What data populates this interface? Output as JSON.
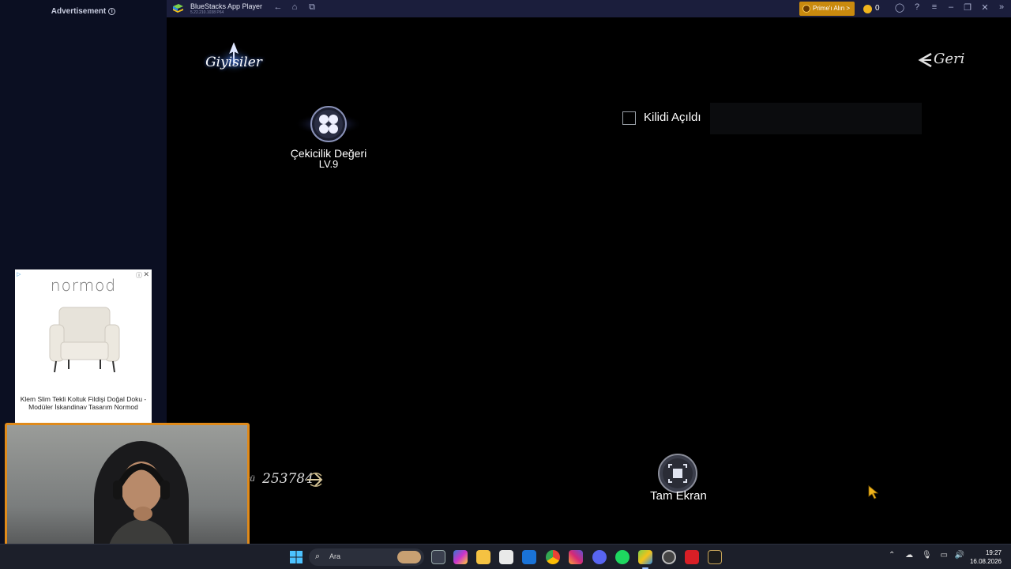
{
  "sidebar": {
    "ad_label": "Advertisement",
    "ad": {
      "brand": "normod",
      "caption": "Klem Slim Tekli Koltuk Fildişi Doğal Doku - Modüler İskandinav Tasarım Normod"
    }
  },
  "titlebar": {
    "app_name": "BlueStacks App Player",
    "version": "5.22.210.1038  P64",
    "prime_button": "Prime'ı Alın >",
    "coin_count": "0"
  },
  "game": {
    "clothes_tab": "Giyisiler",
    "back_button": "Geri",
    "charm": {
      "name": "Çekicilik Değeri",
      "level": "LV.9"
    },
    "unlock_filter": {
      "label": "Kilidi Açıldı",
      "checked": false
    },
    "currency": {
      "prefix": "cü",
      "value": "253784"
    },
    "fullscreen_button": "Tam Ekran"
  },
  "taskbar": {
    "search_placeholder": "Ara",
    "apps": [
      "file-explorer-icon",
      "m365-icon",
      "folder-icon",
      "store-icon",
      "outlook-icon",
      "chrome-icon",
      "instagram-icon",
      "discord-icon",
      "spotify-icon",
      "bluestacks-icon",
      "obs-icon",
      "netflix-icon",
      "league-icon"
    ],
    "time": "19:27",
    "date": "16.08.2026"
  },
  "colors": {
    "accent_orange": "#e08a1a",
    "titlebar_bg": "#1b1e3c",
    "prime_gold": "#c98a0e"
  }
}
